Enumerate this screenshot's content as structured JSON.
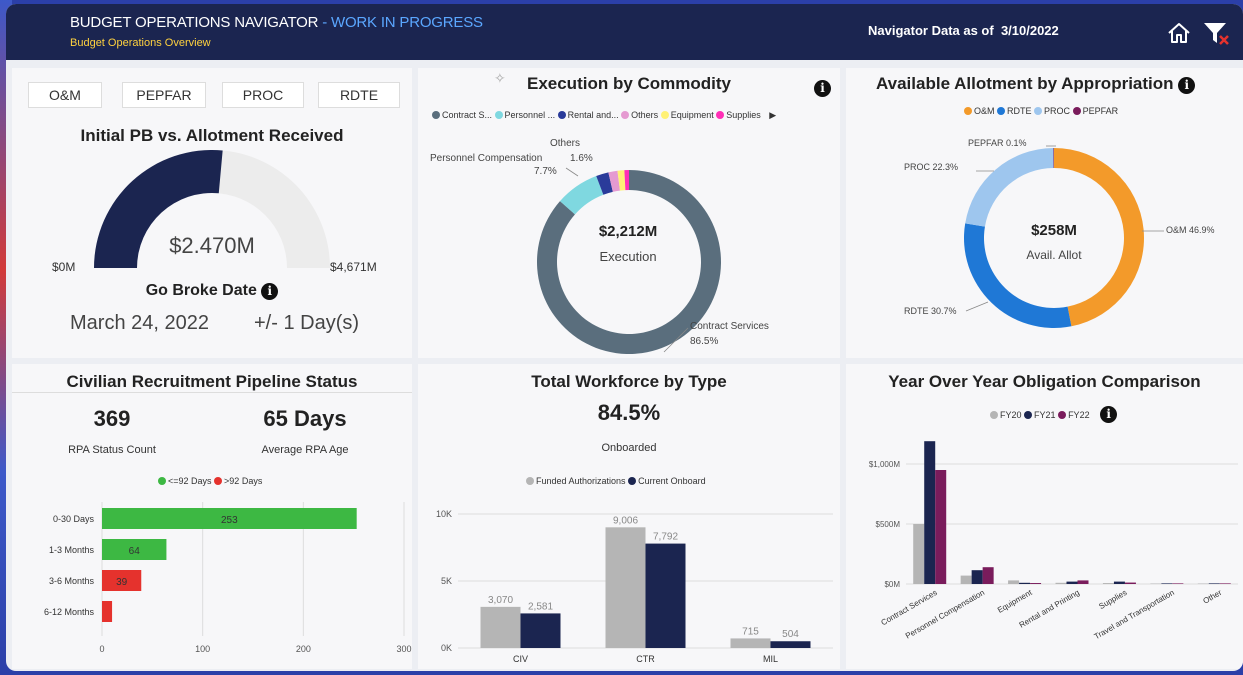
{
  "header": {
    "title": "BUDGET OPERATIONS NAVIGATOR",
    "title_suffix": " - WORK IN PROGRESS",
    "subtitle": "Budget Operations Overview",
    "as_of_label": "Navigator Data as of",
    "as_of_date": "3/10/2022",
    "icons": [
      "home-icon",
      "clear-filter-icon"
    ]
  },
  "tabs": [
    "O&M",
    "PEPFAR",
    "PROC",
    "RDTE"
  ],
  "gauge": {
    "title": "Initial PB vs. Allotment Received",
    "value_label": "$2.470M",
    "min_label": "$0M",
    "max_label": "$4,671M",
    "value": 2470,
    "max": 4671,
    "fill_color": "#1b2550",
    "track_color": "#ececec"
  },
  "go_broke": {
    "label": "Go Broke Date",
    "date": "March 24, 2022",
    "tolerance": "+/- 1 Day(s)"
  },
  "execution": {
    "title": "Execution by Commodity",
    "legend": [
      {
        "label": "Contract S...",
        "color": "#5a6e7d"
      },
      {
        "label": "Personnel ...",
        "color": "#7fd8e0"
      },
      {
        "label": "Rental and...",
        "color": "#2a3b9a"
      },
      {
        "label": "Others",
        "color": "#e59ad1"
      },
      {
        "label": "Equipment",
        "color": "#fff176"
      },
      {
        "label": "Supplies",
        "color": "#ff2fb6"
      }
    ],
    "center_value": "$2,212M",
    "center_label": "Execution",
    "labels": {
      "others": "Others",
      "others_pct": "1.6%",
      "personnel": "Personnel Compensation",
      "personnel_pct": "7.7%",
      "contract": "Contract Services",
      "contract_pct": "86.5%"
    }
  },
  "allotment": {
    "title": "Available Allotment by Appropriation",
    "legend": [
      {
        "label": "O&M",
        "color": "#f39a2a"
      },
      {
        "label": "RDTE",
        "color": "#1f78d6"
      },
      {
        "label": "PROC",
        "color": "#9ec6ee"
      },
      {
        "label": "PEPFAR",
        "color": "#7a1c5c"
      }
    ],
    "center_value": "$258M",
    "center_label": "Avail. Allot",
    "labels": {
      "pepfar": "PEPFAR 0.1%",
      "proc": "PROC 22.3%",
      "om": "O&M 46.9%",
      "rdte": "RDTE 30.7%"
    }
  },
  "recruitment": {
    "title": "Civilian Recruitment Pipeline Status",
    "count": "369",
    "count_label": "RPA Status Count",
    "age": "65 Days",
    "age_label": "Average RPA Age",
    "legend": [
      {
        "label": "<=92 Days",
        "color": "#3db843"
      },
      {
        "label": ">92 Days",
        "color": "#e5322d"
      }
    ],
    "x_ticks": [
      "0",
      "100",
      "200",
      "300"
    ]
  },
  "workforce": {
    "title": "Total Workforce by Type",
    "pct": "84.5%",
    "pct_label": "Onboarded",
    "legend": [
      {
        "label": "Funded Authorizations",
        "color": "#b5b5b5"
      },
      {
        "label": "Current Onboard",
        "color": "#1b2550"
      }
    ],
    "y_ticks": [
      "10K",
      "5K",
      "0K"
    ]
  },
  "yoy": {
    "title": "Year Over Year Obligation Comparison",
    "legend": [
      {
        "label": "FY20",
        "color": "#b5b5b5"
      },
      {
        "label": "FY21",
        "color": "#1b2550"
      },
      {
        "label": "FY22",
        "color": "#7a1c5c"
      }
    ],
    "y_ticks": [
      "$1,000M",
      "$500M",
      "$0M"
    ]
  },
  "chart_data": [
    {
      "type": "bar",
      "title": "Civilian Recruitment Pipeline Status",
      "orientation": "horizontal",
      "categories": [
        "0-30 Days",
        "1-3 Months",
        "3-6 Months",
        "6-12 Months"
      ],
      "values": [
        253,
        64,
        39,
        10
      ],
      "value_labels": [
        "253",
        "64",
        "39",
        ""
      ],
      "colors": [
        "#3db843",
        "#3db843",
        "#e5322d",
        "#e5322d"
      ],
      "xlim": [
        0,
        300
      ]
    },
    {
      "type": "bar",
      "title": "Total Workforce by Type",
      "categories": [
        "CIV",
        "CTR",
        "MIL"
      ],
      "series": [
        {
          "name": "Funded Authorizations",
          "values": [
            3070,
            9006,
            715
          ],
          "color": "#b5b5b5"
        },
        {
          "name": "Current Onboard",
          "values": [
            2581,
            7792,
            504
          ],
          "color": "#1b2550"
        }
      ],
      "value_labels": [
        [
          "3,070",
          "9,006",
          "715"
        ],
        [
          "2,581",
          "7,792",
          "504"
        ]
      ],
      "ylim": [
        0,
        10000
      ]
    },
    {
      "type": "bar",
      "title": "Year Over Year Obligation Comparison",
      "categories": [
        "Contract Services",
        "Personnel Compensation",
        "Equipment",
        "Rental and Printing",
        "Supplies",
        "Travel and Transportation",
        "Other"
      ],
      "series": [
        {
          "name": "FY20",
          "values": [
            500,
            70,
            30,
            10,
            8,
            4,
            4
          ],
          "color": "#b5b5b5"
        },
        {
          "name": "FY21",
          "values": [
            1190,
            115,
            10,
            20,
            20,
            5,
            5
          ],
          "color": "#1b2550"
        },
        {
          "name": "FY22",
          "values": [
            950,
            140,
            8,
            30,
            12,
            5,
            5
          ],
          "color": "#7a1c5c"
        }
      ],
      "ylim": [
        0,
        1250
      ]
    },
    {
      "type": "pie",
      "title": "Execution by Commodity",
      "labels": [
        "Contract Services",
        "Personnel Compensation",
        "Rental and Printing",
        "Others",
        "Equipment",
        "Supplies"
      ],
      "values": [
        86.5,
        7.7,
        2.2,
        1.6,
        1.2,
        0.8
      ],
      "colors": [
        "#5a6e7d",
        "#7fd8e0",
        "#2a3b9a",
        "#e59ad1",
        "#fff176",
        "#ff2fb6"
      ]
    },
    {
      "type": "pie",
      "title": "Available Allotment by Appropriation",
      "labels": [
        "O&M",
        "RDTE",
        "PROC",
        "PEPFAR"
      ],
      "values": [
        46.9,
        30.7,
        22.3,
        0.1
      ],
      "colors": [
        "#f39a2a",
        "#1f78d6",
        "#9ec6ee",
        "#7a1c5c"
      ]
    }
  ]
}
